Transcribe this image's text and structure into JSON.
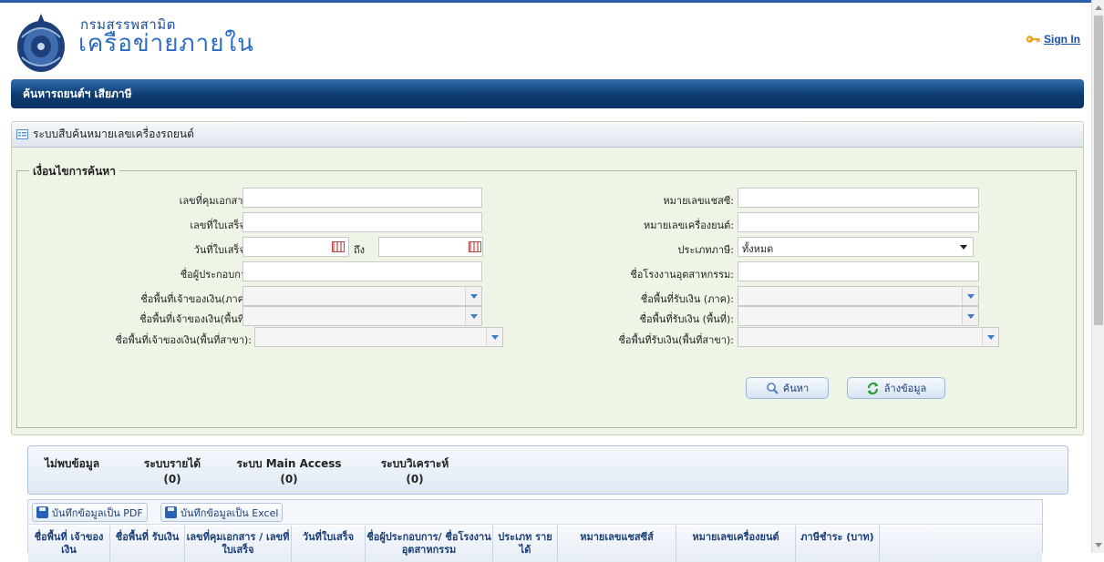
{
  "header": {
    "brand_top": "กรมสรรพสามิต",
    "brand_main": "เครือข่ายภายใน",
    "signin_label": "Sign In"
  },
  "nav": {
    "title": "ค้นหารถยนต์ฯ เสียภาษี"
  },
  "panel": {
    "title": "ระบบสืบค้นหมายเลขเครื่องรถยนต์",
    "legend": "เงื่อนไขการค้นหา"
  },
  "form": {
    "doc_no_label": "เลขที่คุมเอกสาร:",
    "receipt_no_label": "เลขที่ใบเสร็จ :",
    "receipt_date_label": "วันที่ใบเสร็จ :",
    "to_label": "ถึง",
    "operator_label": "ชื่อผู้ประกอบการ",
    "payer_region_label": "ชื่อพื้นที่เจ้าของเงิน(ภาค):",
    "payer_area_label": "ชื่อพื้นที่เจ้าของเงิน(พื้นที่):",
    "payer_branch_label": "ชื่อพื้นที่เจ้าของเงิน(พื้นที่สาขา):",
    "chassis_label": "หมายเลขแชสซี:",
    "engine_label": "หมายเลขเครื่องยนต์:",
    "tax_type_label": "ประเภทภาษี:",
    "tax_type_value": "ทั้งหมด",
    "factory_label": "ชื่อโรงงานอุตสาหกรรม:",
    "recv_region_label": "ชื่อพื้นที่รับเงิน (ภาค):",
    "recv_area_label": "ชื่อพื้นที่รับเงิน (พื้นที่):",
    "recv_branch_label": "ชื่อพื้นที่รับเงิน(พื้นที่สาขา):",
    "search_button": "ค้นหา",
    "clear_button": "ล้างข้อมูล"
  },
  "summary": {
    "no_data": "ไม่พบข้อมูล",
    "income_label": "ระบบรายได้",
    "income_count": "(0)",
    "main_access_label": "ระบบ Main Access",
    "main_access_count": "(0)",
    "analysis_label": "ระบบวิเคราะห์",
    "analysis_count": "(0)"
  },
  "grid": {
    "save_pdf": "บันทึกข้อมูลเป็น PDF",
    "save_excel": "บันทึกข้อมูลเป็น Excel",
    "columns": [
      "ชื่อพื้นที่ เจ้าของเงิน",
      "ชื่อพื้นที่ รับเงิน",
      "เลขที่คุมเอกสาร / เลขที่ใบเสร็จ",
      "วันที่ใบเสร็จ",
      "ชื่อผู้ประกอบการ/ ชื่อโรงงานอุตสาหกรรม",
      "ประเภท รายได้",
      "หมายเลขแชสซีส์",
      "หมายเลขเครื่องยนต์",
      "ภาษีชำระ (บาท)"
    ]
  },
  "colors": {
    "nav_dark": "#0c3a6e",
    "panel_bg": "#eef5e6",
    "link": "#1a4fb0"
  }
}
